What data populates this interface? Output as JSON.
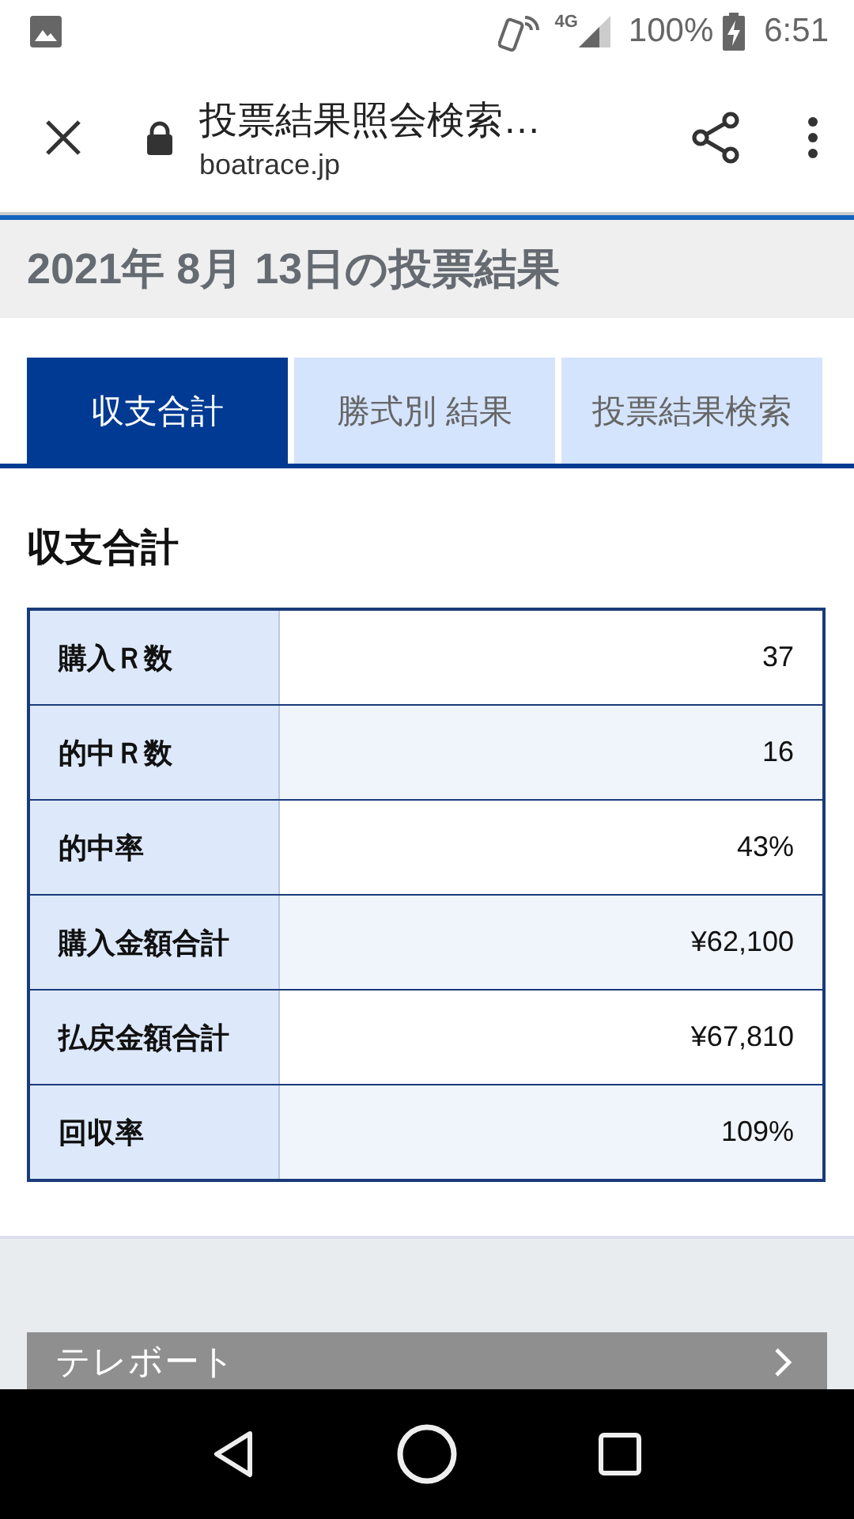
{
  "status_bar": {
    "battery": "100%",
    "time": "6:51",
    "network": "4G"
  },
  "browser": {
    "title": "投票結果照会検索…",
    "url": "boatrace.jp"
  },
  "heading": "2021年 8月 13日の投票結果",
  "tabs": [
    {
      "label": "収支合計",
      "selected": true
    },
    {
      "label": "勝式別 結果",
      "selected": false
    },
    {
      "label": "投票結果検索",
      "selected": false
    }
  ],
  "section_title": "収支合計",
  "table": {
    "rows": [
      {
        "label": "購入Ｒ数",
        "value": "37"
      },
      {
        "label": "的中Ｒ数",
        "value": "16"
      },
      {
        "label": "的中率",
        "value": "43%"
      },
      {
        "label": "購入金額合計",
        "value": "¥62,100"
      },
      {
        "label": "払戻金額合計",
        "value": "¥67,810"
      },
      {
        "label": "回収率",
        "value": "109%"
      }
    ]
  },
  "link_button": {
    "label": "テレボート"
  }
}
